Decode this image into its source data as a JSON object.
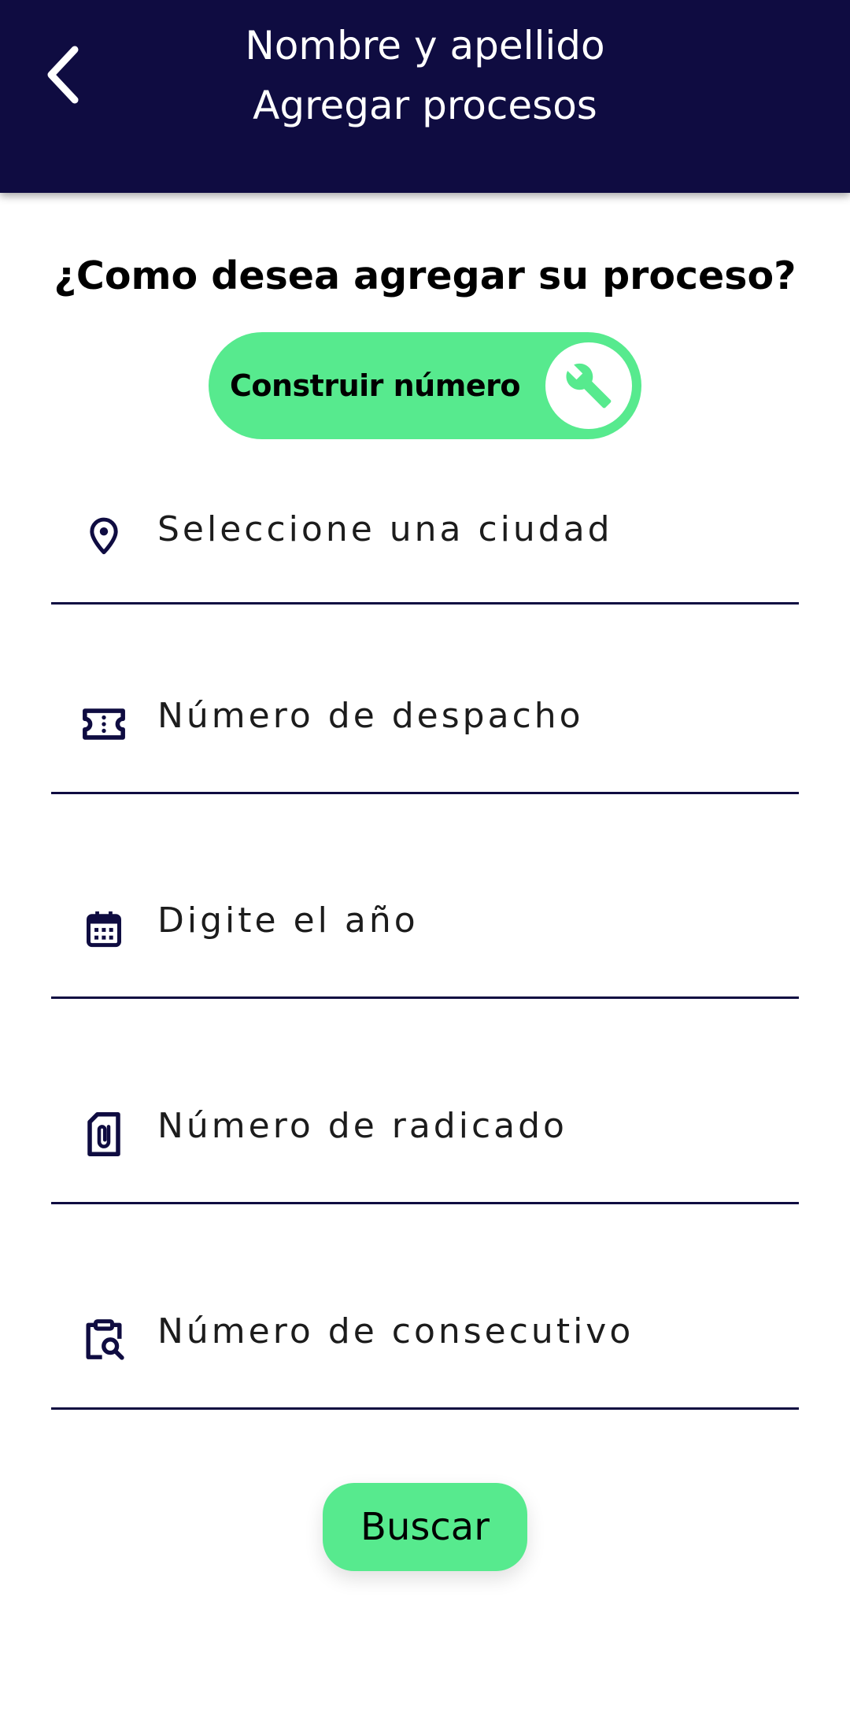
{
  "header": {
    "title_line1": "Nombre y apellido",
    "title_line2": "Agregar procesos",
    "back_icon": "chevron-left-icon"
  },
  "main": {
    "question": "¿Como desea agregar su proceso?",
    "build_button": {
      "label": "Construir número",
      "icon": "wrench-icon"
    },
    "fields": [
      {
        "placeholder": "Seleccione una ciudad",
        "icon": "location-pin-icon"
      },
      {
        "placeholder": "Número de despacho",
        "icon": "ticket-icon"
      },
      {
        "placeholder": "Digite el año",
        "icon": "calendar-icon"
      },
      {
        "placeholder": "Número de radicado",
        "icon": "paperclip-file-icon"
      },
      {
        "placeholder": "Número de consecutivo",
        "icon": "clipboard-search-icon"
      }
    ],
    "search_button": {
      "label": "Buscar"
    }
  },
  "colors": {
    "header_background": "#0f0c41",
    "accent_green": "#57ea8e",
    "icon_color": "#0f0c41",
    "divider": "#0f0c41"
  }
}
